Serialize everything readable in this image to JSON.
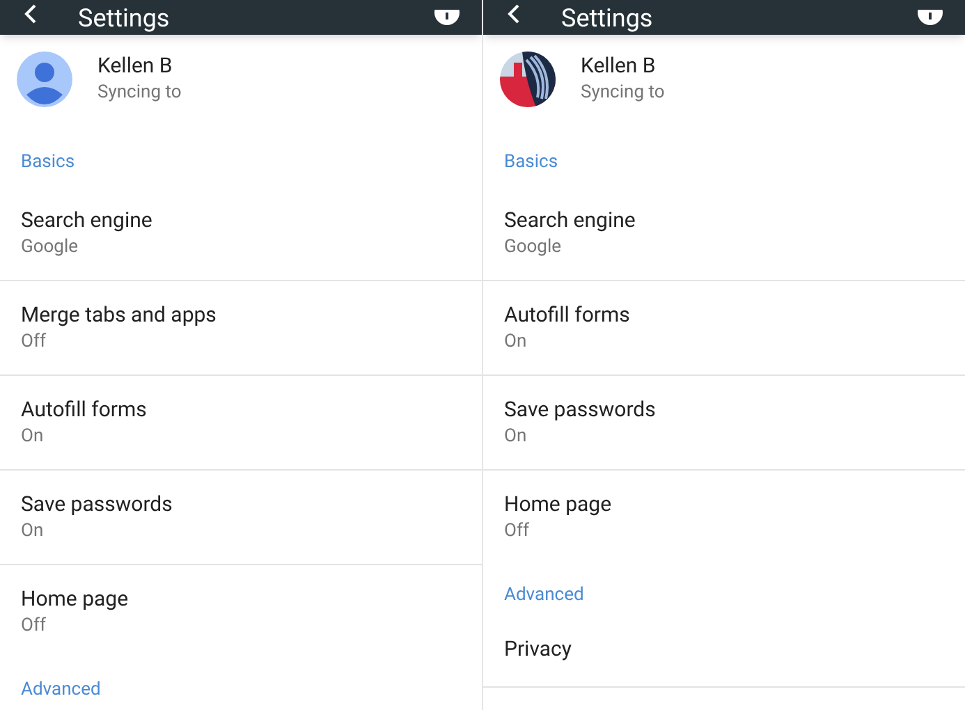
{
  "panels": [
    {
      "title": "Settings",
      "account": {
        "name": "Kellen B",
        "status": "Syncing to",
        "kind": "silhouette"
      },
      "sections": [
        {
          "heading": "Basics",
          "items": [
            {
              "title": "Search engine",
              "value": "Google"
            },
            {
              "title": "Merge tabs and apps",
              "value": "Off"
            },
            {
              "title": "Autofill forms",
              "value": "On"
            },
            {
              "title": "Save passwords",
              "value": "On"
            },
            {
              "title": "Home page",
              "value": "Off"
            }
          ]
        },
        {
          "heading": "Advanced"
        }
      ]
    },
    {
      "title": "Settings",
      "account": {
        "name": "Kellen B",
        "status": "Syncing to",
        "kind": "picture"
      },
      "sections": [
        {
          "heading": "Basics",
          "items": [
            {
              "title": "Search engine",
              "value": "Google"
            },
            {
              "title": "Autofill forms",
              "value": "On"
            },
            {
              "title": "Save passwords",
              "value": "On"
            },
            {
              "title": "Home page",
              "value": "Off"
            }
          ]
        },
        {
          "heading": "Advanced",
          "items": [
            {
              "title": "Privacy"
            }
          ]
        }
      ]
    }
  ]
}
